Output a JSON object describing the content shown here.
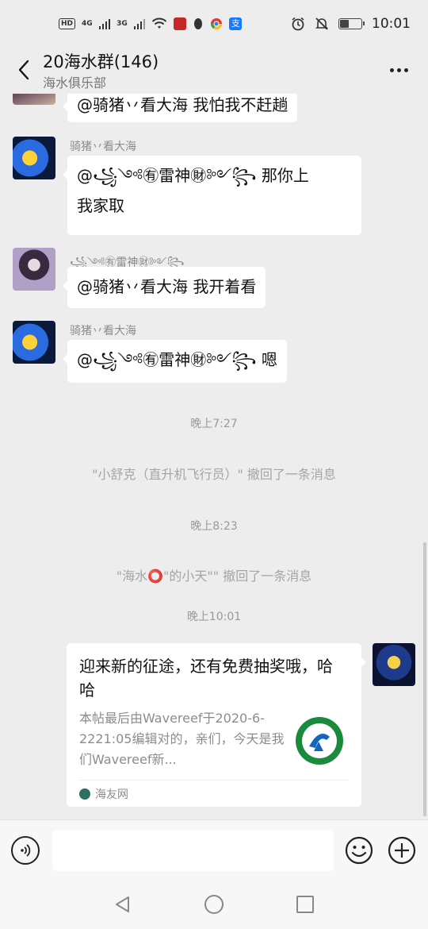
{
  "status_bar": {
    "hd_label": "HD",
    "net1": "4G",
    "net2": "3G",
    "time": "10:01",
    "battery_level": 0.4,
    "icons": [
      "signal-icon",
      "wifi-icon",
      "alarm-icon",
      "mute-icon",
      "battery-icon"
    ]
  },
  "header": {
    "title": "20海水群(146)",
    "subtitle": "海水俱乐部"
  },
  "messages": [
    {
      "sender": "",
      "text": "@骑猪丷看大海 我怕我不赶趟"
    },
    {
      "sender": "骑猪丷看大海",
      "mention": "@꧁༺㊒雷神㊖༻꧂",
      "text_suffix": " 那你上",
      "text_line2": "我家取"
    },
    {
      "sender": "꧁༺㊒雷神㊖༻꧂",
      "text": "@骑猪丷看大海 我开着看"
    },
    {
      "sender": "骑猪丷看大海",
      "mention": "@꧁༺㊒雷神㊖༻꧂",
      "text_suffix": " 嗯"
    }
  ],
  "time_labels": [
    "晚上7:27",
    "晚上8:23",
    "晚上10:01"
  ],
  "system_notices": [
    "\"小舒克（直升机飞行员）\" 撤回了一条消息",
    "\"海水⭕\"的小天\"\" 撤回了一条消息"
  ],
  "shared_card": {
    "title": "迎来新的征途，还有免费抽奖哦，哈哈",
    "description": "本帖最后由Wavereef于2020-6-2221:05编辑对的，亲们，今天是我们Wavereef新...",
    "source": "海友网"
  },
  "input": {
    "placeholder": "",
    "value": ""
  },
  "colors": {
    "background": "#ededed",
    "bubble": "#ffffff",
    "card_logo": "#1a8a3c"
  }
}
